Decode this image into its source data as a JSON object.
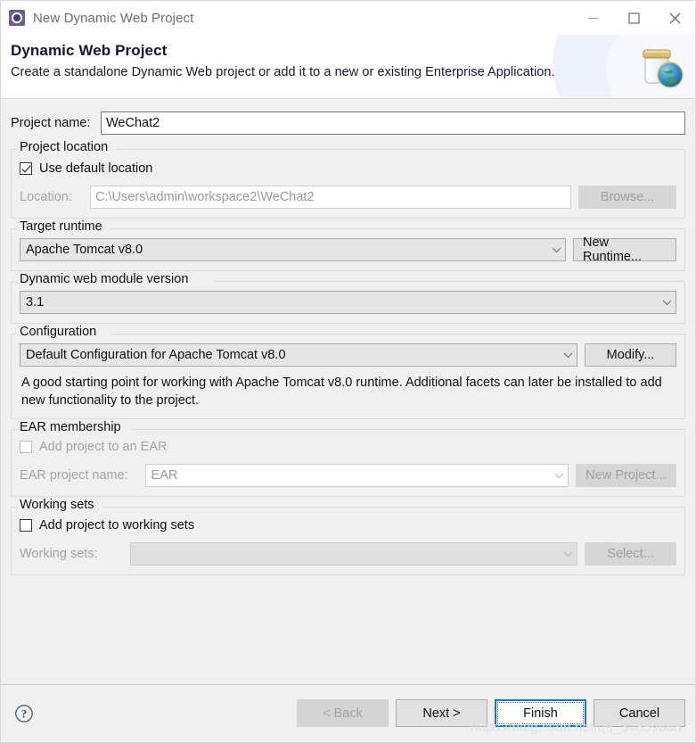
{
  "window": {
    "title": "New Dynamic Web Project",
    "icon": "eclipse-wizard-icon",
    "minimize_label": "Minimize",
    "maximize_label": "Maximize",
    "close_label": "Close"
  },
  "banner": {
    "title": "Dynamic Web Project",
    "subtitle": "Create a standalone Dynamic Web project or add it to a new or existing Enterprise Application.",
    "icon": "jar-globe-icon"
  },
  "project_name": {
    "label": "Project name:",
    "value": "WeChat2",
    "placeholder": ""
  },
  "project_location": {
    "group_title": "Project location",
    "use_default_label": "Use default location",
    "use_default_checked": true,
    "location_label": "Location:",
    "location_value": "C:\\Users\\admin\\workspace2\\WeChat2",
    "browse_label": "Browse..."
  },
  "target_runtime": {
    "group_title": "Target runtime",
    "selected": "Apache Tomcat v8.0",
    "new_runtime_label": "New Runtime..."
  },
  "module_version": {
    "group_title": "Dynamic web module version",
    "selected": "3.1"
  },
  "configuration": {
    "group_title": "Configuration",
    "selected": "Default Configuration for Apache Tomcat v8.0",
    "modify_label": "Modify...",
    "description": "A good starting point for working with Apache Tomcat v8.0 runtime. Additional facets can later be installed to add new functionality to the project."
  },
  "ear_membership": {
    "group_title": "EAR membership",
    "add_to_ear_label": "Add project to an EAR",
    "add_to_ear_checked": false,
    "ear_project_name_label": "EAR project name:",
    "ear_project_name_value": "EAR",
    "new_project_label": "New Project..."
  },
  "working_sets": {
    "group_title": "Working sets",
    "add_to_working_sets_label": "Add project to working sets",
    "add_to_working_sets_checked": false,
    "working_sets_label": "Working sets:",
    "working_sets_value": "",
    "select_label": "Select..."
  },
  "footer": {
    "help_icon": "help-icon",
    "back_label": "< Back",
    "next_label": "Next >",
    "finish_label": "Finish",
    "cancel_label": "Cancel"
  },
  "watermark": {
    "text": "https://blog.csdn.net/qq_34859668"
  },
  "colors": {
    "accent": "#1177d1",
    "body_bg": "#f0f0f0",
    "banner_bg": "#ffffff",
    "disabled_text": "#a4a4a4"
  }
}
